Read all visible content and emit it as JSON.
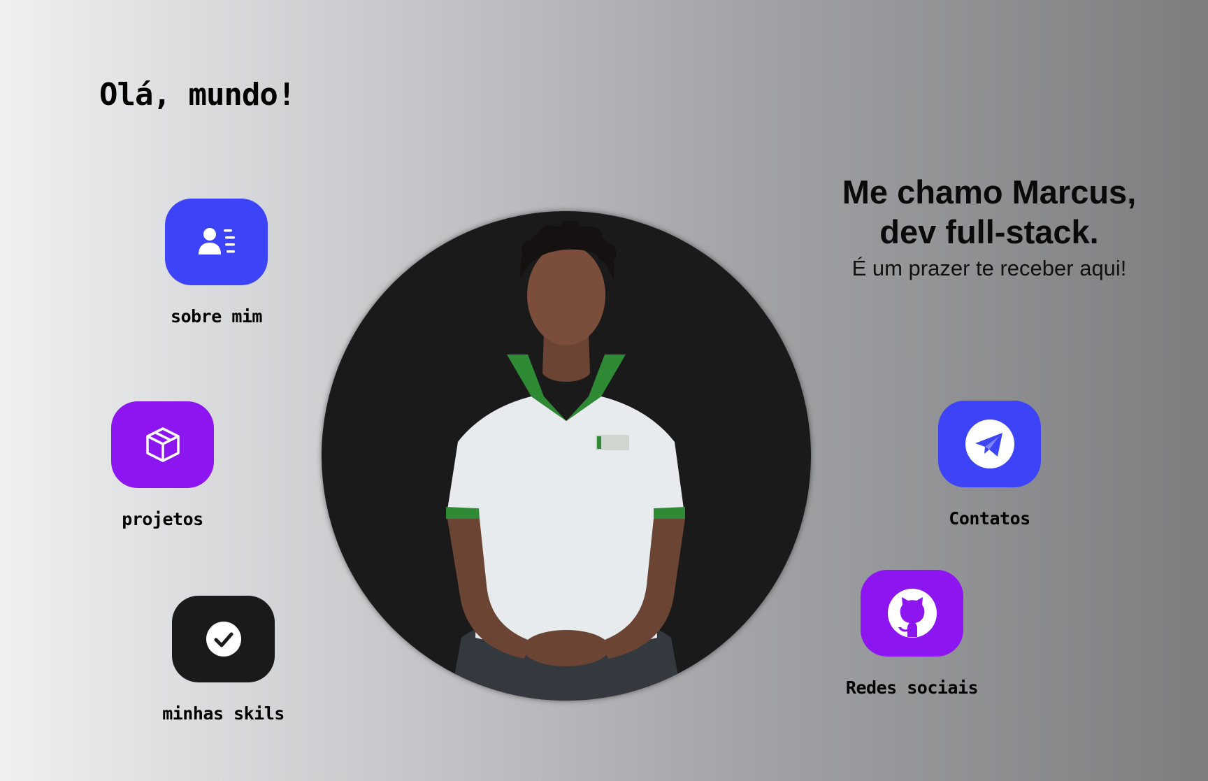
{
  "header": {
    "greeting": "Olá, mundo!"
  },
  "nav": {
    "about": {
      "label": "sobre mim",
      "icon": "profile-card-icon",
      "color": "#3d43f7"
    },
    "projects": {
      "label": "projetos",
      "icon": "package-box-icon",
      "color": "#8c15f0"
    },
    "skills": {
      "label": "minhas skils",
      "icon": "check-circle-icon",
      "color": "#1a1a1a"
    },
    "contacts": {
      "label": "Contatos",
      "icon": "telegram-icon",
      "color": "#3d43f7"
    },
    "social": {
      "label": "Redes sociais",
      "icon": "github-icon",
      "color": "#8c15f0"
    }
  },
  "intro": {
    "headline_line1": "Me chamo Marcus,",
    "headline_line2": "dev full-stack.",
    "subtitle": "É um prazer te receber aqui!"
  },
  "portrait": {
    "background_color": "#1a1a1a",
    "shirt_collar_color": "#2f8a35"
  }
}
